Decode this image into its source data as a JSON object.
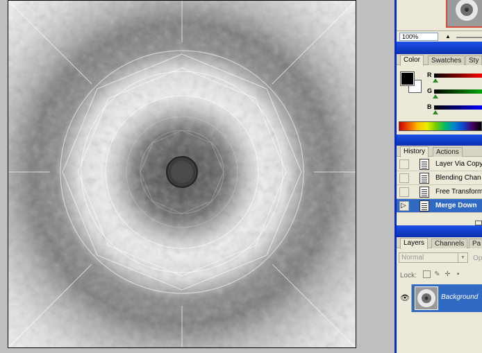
{
  "navigator": {
    "zoom": "100%"
  },
  "color_panel": {
    "tabs": [
      "Color",
      "Swatches",
      "Sty"
    ],
    "active_tab": "Color",
    "channels": [
      {
        "label": "R",
        "color": "#ff0000"
      },
      {
        "label": "G",
        "color": "#00aa00"
      },
      {
        "label": "B",
        "color": "#0000ff"
      }
    ],
    "foreground": "#000000",
    "background": "#ffffff"
  },
  "history_panel": {
    "tabs": [
      "History",
      "Actions"
    ],
    "active_tab": "History",
    "items": [
      {
        "label": "Layer Via Copy",
        "selected": false
      },
      {
        "label": "Blending Chan",
        "selected": false
      },
      {
        "label": "Free Transform",
        "selected": false
      },
      {
        "label": "Merge Down",
        "selected": true
      }
    ]
  },
  "layers_panel": {
    "tabs": [
      "Layers",
      "Channels",
      "Pa"
    ],
    "active_tab": "Layers",
    "blend_mode": "Normal",
    "opacity_label": "Op",
    "lock_label": "Lock:",
    "layers": [
      {
        "name": "Background",
        "visible": true
      }
    ]
  },
  "colors": {
    "selection_blue": "#316ac5",
    "title_blue": "#0b2bb8",
    "panel_bg": "#ece9d8"
  }
}
